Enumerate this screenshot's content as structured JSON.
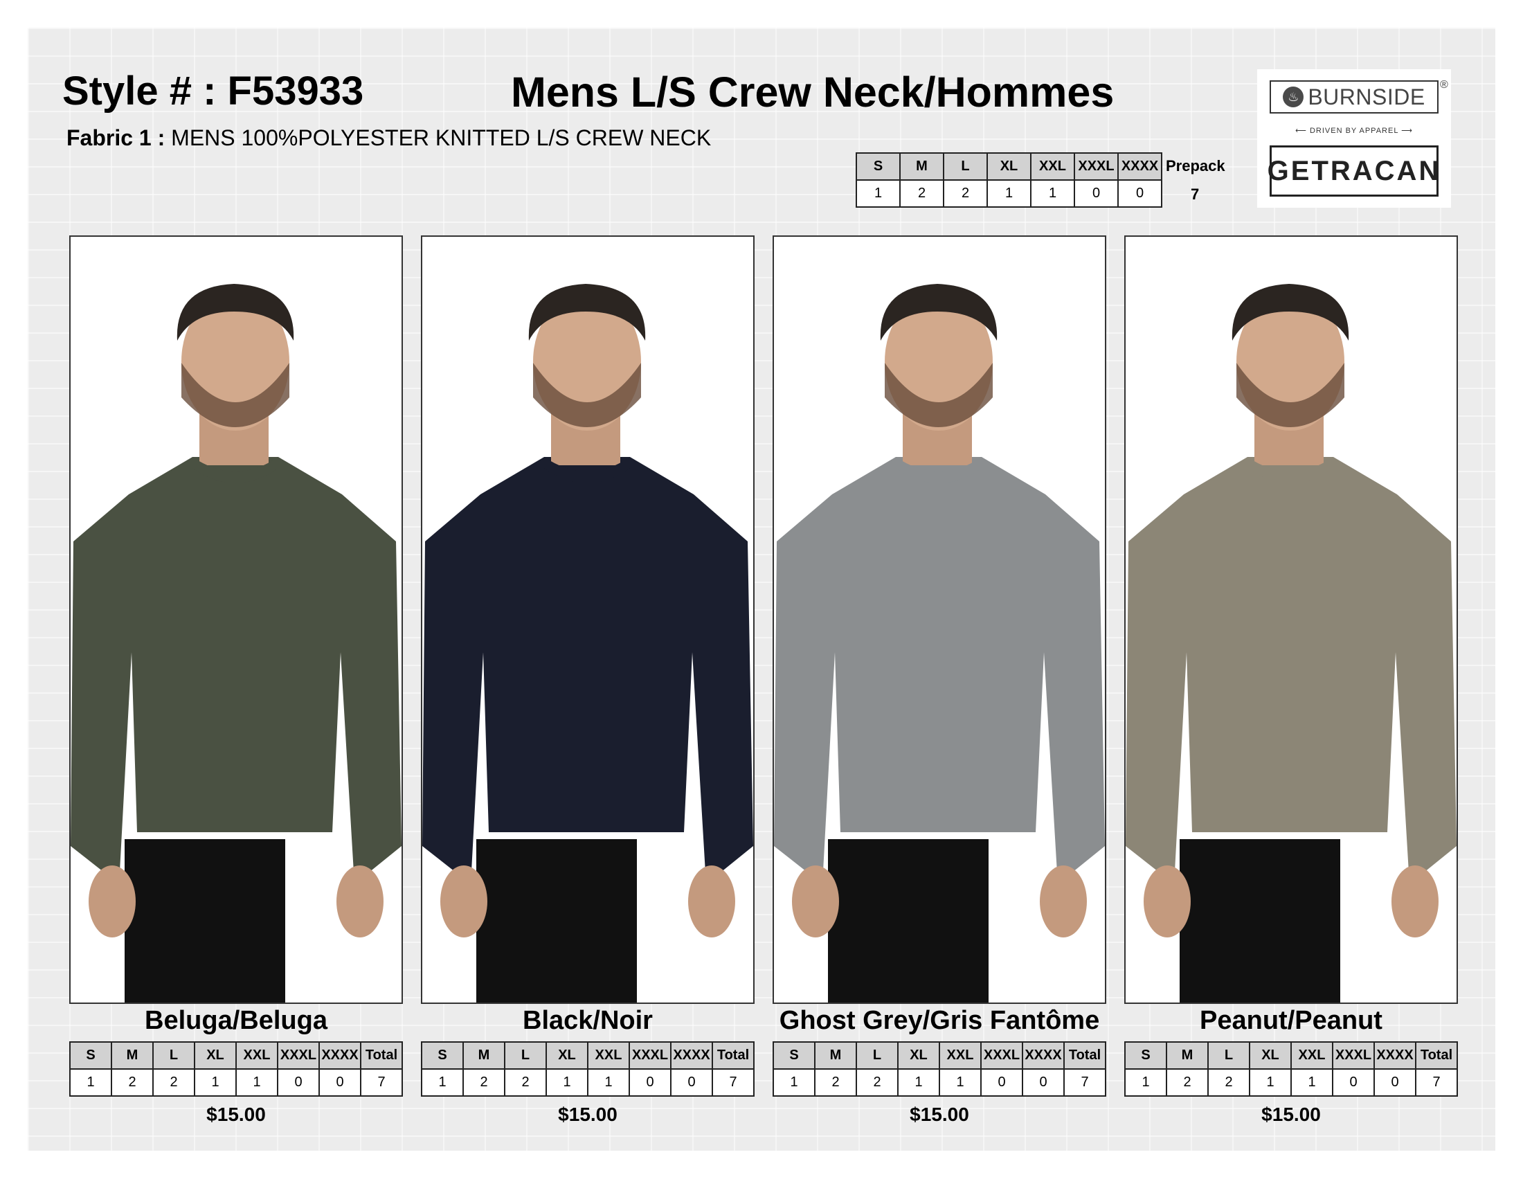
{
  "header": {
    "style_number": "Style # : F53933",
    "title": "Mens L/S Crew Neck/Hommes",
    "fabric_label": "Fabric 1 :",
    "fabric_value": "MENS 100%POLYESTER KNITTED L/S CREW NECK"
  },
  "prepack": {
    "sizes": [
      "S",
      "M",
      "L",
      "XL",
      "XXL",
      "XXXL",
      "XXXX"
    ],
    "quantities": [
      "1",
      "2",
      "2",
      "1",
      "1",
      "0",
      "0"
    ],
    "label": "Prepack",
    "total": "7"
  },
  "logos": {
    "burnside": "BURNSIDE",
    "registered": "®",
    "tagline": "⟵ DRIVEN BY APPAREL ⟶",
    "getracan": "GETRACAN"
  },
  "products": [
    {
      "color_name": "Beluga/Beluga",
      "sweater_color": "#4a5142",
      "sizes": [
        "S",
        "M",
        "L",
        "XL",
        "XXL",
        "XXXL",
        "XXXX",
        "Total"
      ],
      "quantities": [
        "1",
        "2",
        "2",
        "1",
        "1",
        "0",
        "0",
        "7"
      ],
      "price": "$15.00"
    },
    {
      "color_name": "Black/Noir",
      "sweater_color": "#1a1e2e",
      "sizes": [
        "S",
        "M",
        "L",
        "XL",
        "XXL",
        "XXXL",
        "XXXX",
        "Total"
      ],
      "quantities": [
        "1",
        "2",
        "2",
        "1",
        "1",
        "0",
        "0",
        "7"
      ],
      "price": "$15.00"
    },
    {
      "color_name": "Ghost Grey/Gris Fantôme",
      "sweater_color": "#8b8e90",
      "sizes": [
        "S",
        "M",
        "L",
        "XL",
        "XXL",
        "XXXL",
        "XXXX",
        "Total"
      ],
      "quantities": [
        "1",
        "2",
        "2",
        "1",
        "1",
        "0",
        "0",
        "7"
      ],
      "price": "$15.00"
    },
    {
      "color_name": "Peanut/Peanut",
      "sweater_color": "#8c8676",
      "sizes": [
        "S",
        "M",
        "L",
        "XL",
        "XXL",
        "XXXL",
        "XXXX",
        "Total"
      ],
      "quantities": [
        "1",
        "2",
        "2",
        "1",
        "1",
        "0",
        "0",
        "7"
      ],
      "price": "$15.00"
    }
  ]
}
